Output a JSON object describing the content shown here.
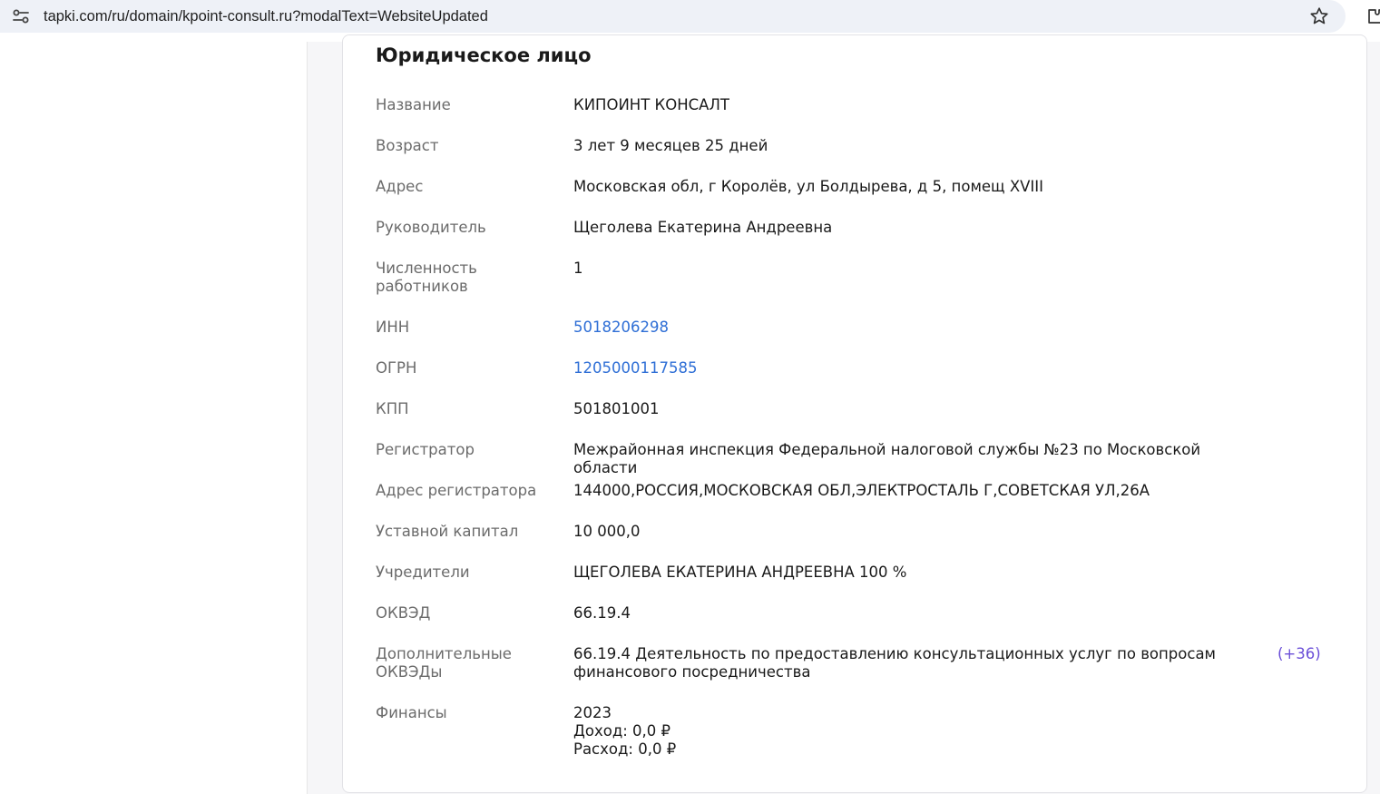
{
  "browser": {
    "url": "tapki.com/ru/domain/kpoint-consult.ru?modalText=WebsiteUpdated"
  },
  "card": {
    "title": "Юридическое лицо",
    "rows": [
      {
        "label": "Название",
        "value": "КИПОИНТ КОНСАЛТ"
      },
      {
        "label": "Возраст",
        "value": "3 лет 9 месяцев 25 дней"
      },
      {
        "label": "Адрес",
        "value": "Московская обл, г Королёв, ул Болдырева, д 5, помещ XVIII"
      },
      {
        "label": "Руководитель",
        "value": "Щеголева Екатерина Андреевна"
      },
      {
        "label_lines": [
          "Численность",
          "работников"
        ],
        "value": "1"
      },
      {
        "label": "ИНН",
        "value": "5018206298"
      },
      {
        "label": "ОГРН",
        "value": "1205000117585"
      },
      {
        "label": "КПП",
        "value": "501801001"
      },
      {
        "label": "Регистратор",
        "value": "Межрайонная инспекция Федеральной налоговой службы №23 по Московской области"
      },
      {
        "label": "Адрес регистратора",
        "value": "144000,РОССИЯ,МОСКОВСКАЯ ОБЛ,ЭЛЕКТРОСТАЛЬ Г,СОВЕТСКАЯ УЛ,26А"
      },
      {
        "label": "Уставной капитал",
        "value": "10 000,0"
      },
      {
        "label": "Учредители",
        "value": "ЩЕГОЛЕВА ЕКАТЕРИНА АНДРЕЕВНА 100 %"
      },
      {
        "label": "ОКВЭД",
        "value": "66.19.4"
      },
      {
        "label_lines": [
          "Дополнительные",
          "ОКВЭДы"
        ],
        "value_lines": [
          "66.19.4 Деятельность по предоставлению консультационных услуг по вопросам",
          "финансового посредничества"
        ],
        "extra": "(+36)"
      },
      {
        "label": "Финансы",
        "value_lines": [
          "2023",
          "Доход: 0,0 ₽",
          "Расход: 0,0 ₽"
        ]
      }
    ]
  }
}
